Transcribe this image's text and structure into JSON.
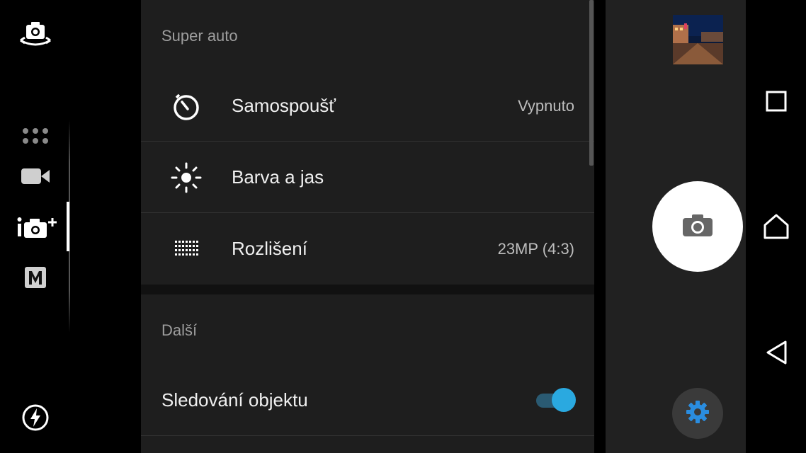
{
  "left_rail": {
    "switch_camera_icon": "switch-camera-icon",
    "modes": [
      {
        "name": "more-modes-icon"
      },
      {
        "name": "video-mode-icon"
      },
      {
        "name": "superior-auto-icon",
        "active": true
      },
      {
        "name": "manual-mode-icon",
        "label": "M"
      }
    ],
    "flash_icon": "flash-auto-icon"
  },
  "settings": {
    "section1_title": "Super auto",
    "rows": [
      {
        "label": "Samospoušť",
        "value": "Vypnuto",
        "icon": "self-timer-icon"
      },
      {
        "label": "Barva a jas",
        "value": "",
        "icon": "brightness-icon"
      },
      {
        "label": "Rozlišení",
        "value": "23MP (4:3)",
        "icon": "resolution-grid-icon"
      }
    ],
    "section2_title": "Další",
    "toggles": [
      {
        "label": "Sledování objektu",
        "on": true
      }
    ]
  },
  "right_col": {
    "thumbnail_icon": "gallery-thumbnail",
    "shutter_icon": "camera-icon",
    "settings_icon": "gear-icon"
  },
  "nav": {
    "recents_icon": "recents-icon",
    "home_icon": "home-icon",
    "back_icon": "back-icon"
  },
  "colors": {
    "accent": "#2aa9e0",
    "panel_bg": "#1e1e1e"
  }
}
